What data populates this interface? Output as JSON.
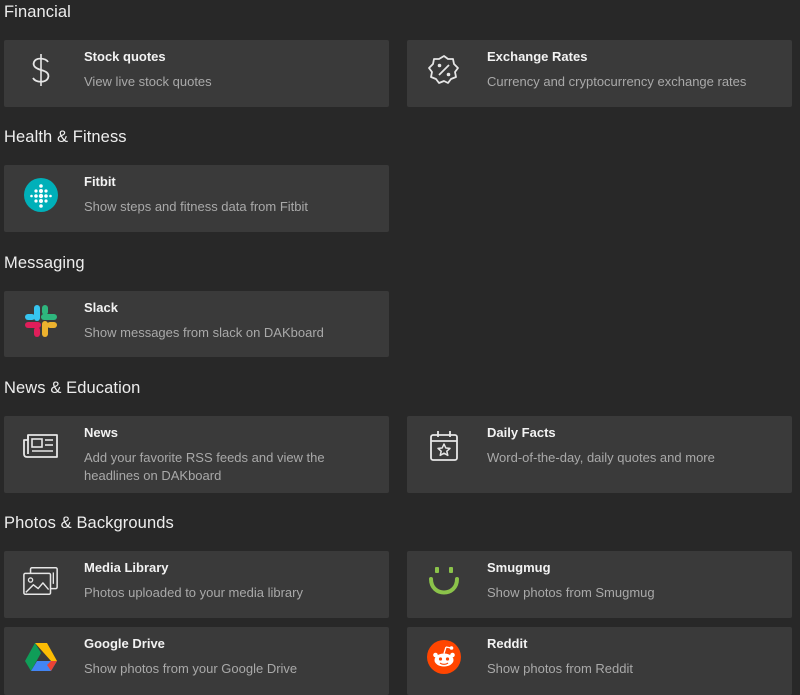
{
  "sections": [
    {
      "title": "Financial"
    },
    {
      "title": "Health & Fitness"
    },
    {
      "title": "Messaging"
    },
    {
      "title": "News & Education"
    },
    {
      "title": "Photos & Backgrounds"
    }
  ],
  "cards": {
    "stock_quotes": {
      "title": "Stock quotes",
      "desc": "View live stock quotes",
      "icon": "dollar-icon"
    },
    "exchange_rates": {
      "title": "Exchange Rates",
      "desc": "Currency and cryptocurrency exchange rates",
      "icon": "percent-badge-icon"
    },
    "fitbit": {
      "title": "Fitbit",
      "desc": "Show steps and fitness data from Fitbit",
      "icon": "fitbit-icon"
    },
    "slack": {
      "title": "Slack",
      "desc": "Show messages from slack on DAKboard",
      "icon": "slack-icon"
    },
    "news": {
      "title": "News",
      "desc": "Add your favorite RSS feeds and view the headlines on DAKboard",
      "icon": "newspaper-icon"
    },
    "daily_facts": {
      "title": "Daily Facts",
      "desc": "Word-of-the-day, daily quotes and more",
      "icon": "calendar-star-icon"
    },
    "media_library": {
      "title": "Media Library",
      "desc": "Photos uploaded to your media library",
      "icon": "photo-library-icon"
    },
    "smugmug": {
      "title": "Smugmug",
      "desc": "Show photos from Smugmug",
      "icon": "smugmug-icon"
    },
    "google_drive": {
      "title": "Google Drive",
      "desc": "Show photos from your Google Drive",
      "icon": "google-drive-icon"
    },
    "reddit": {
      "title": "Reddit",
      "desc": "Show photos from Reddit",
      "icon": "reddit-icon"
    }
  },
  "colors": {
    "background": "#282828",
    "card": "#3a3a3a",
    "fitbit": "#00B0B9",
    "smugmug": "#8BC34A",
    "reddit": "#FF4500"
  }
}
